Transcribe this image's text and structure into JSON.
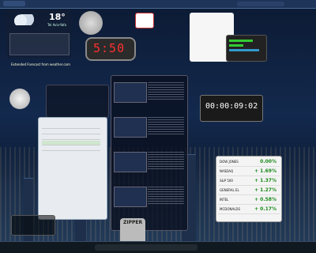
{
  "weather": {
    "temp": "18°",
    "city": "Tel Aviv-Yafo",
    "footer": "Extended Forecast from weather.com"
  },
  "clock": {
    "time": "5:50"
  },
  "countdown": {
    "digits": "00:00:09:02"
  },
  "stocks": {
    "rows": [
      {
        "sym": "DOW JONES",
        "chg": "0.00%"
      },
      {
        "sym": "NASDAQ",
        "chg": "+ 1.69%"
      },
      {
        "sym": "S&P 500",
        "chg": "+ 1.37%"
      },
      {
        "sym": "GENERAL EL",
        "chg": "+ 1.27%"
      },
      {
        "sym": "INTEL",
        "chg": "+ 0.58%"
      },
      {
        "sym": "MCDONALDS",
        "chg": "+ 0.17%"
      }
    ]
  },
  "zipper": {
    "label": "ZIPPER"
  }
}
